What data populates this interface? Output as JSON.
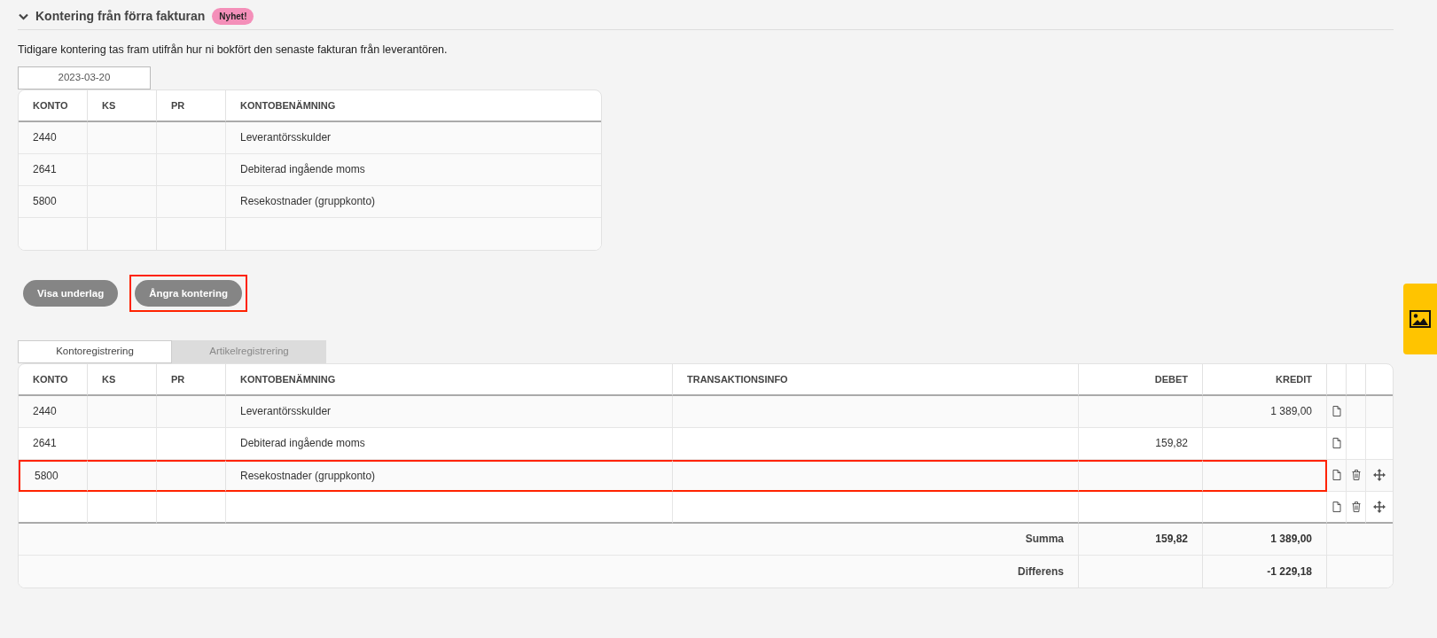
{
  "section": {
    "title": "Kontering från förra fakturan",
    "badge": "Nyhet!",
    "expanded": true,
    "description": "Tidigare kontering tas fram utifrån hur ni bokfört den senaste fakturan från leverantören."
  },
  "previous": {
    "date": "2023-03-20",
    "columns": [
      "KONTO",
      "KS",
      "PR",
      "KONTOBENÄMNING"
    ],
    "rows": [
      {
        "konto": "2440",
        "ks": "",
        "pr": "",
        "name": "Leverantörsskulder"
      },
      {
        "konto": "2641",
        "ks": "",
        "pr": "",
        "name": "Debiterad ingående moms"
      },
      {
        "konto": "5800",
        "ks": "",
        "pr": "",
        "name": "Resekostnader (gruppkonto)"
      },
      {
        "konto": "",
        "ks": "",
        "pr": "",
        "name": ""
      }
    ]
  },
  "buttons": [
    {
      "label": "Visa underlag",
      "highlighted": false
    },
    {
      "label": "Ångra kontering",
      "highlighted": true
    }
  ],
  "tabs": [
    {
      "label": "Kontoregistrering",
      "selected": true
    },
    {
      "label": "Artikelregistrering",
      "selected": false
    }
  ],
  "entries": {
    "columns": [
      "KONTO",
      "KS",
      "PR",
      "KONTOBENÄMNING",
      "TRANSAKTIONSINFO",
      "DEBET",
      "KREDIT"
    ],
    "rows": [
      {
        "konto": "2440",
        "name": "Leverantörsskulder",
        "debet": "",
        "kredit": "1 389,00",
        "deletable": false,
        "movable": false,
        "highlighted": false
      },
      {
        "konto": "2641",
        "name": "Debiterad ingående moms",
        "debet": "159,82",
        "kredit": "",
        "deletable": false,
        "movable": false,
        "highlighted": false
      },
      {
        "konto": "5800",
        "name": "Resekostnader (gruppkonto)",
        "debet": "",
        "kredit": "",
        "deletable": true,
        "movable": true,
        "highlighted": true
      },
      {
        "konto": "",
        "name": "",
        "debet": "",
        "kredit": "",
        "deletable": true,
        "movable": true,
        "highlighted": false
      }
    ],
    "totals": [
      {
        "label": "Summa",
        "debet": "159,82",
        "kredit": "1 389,00"
      },
      {
        "label": "Differens",
        "kredit": "-1 229,18"
      }
    ]
  }
}
